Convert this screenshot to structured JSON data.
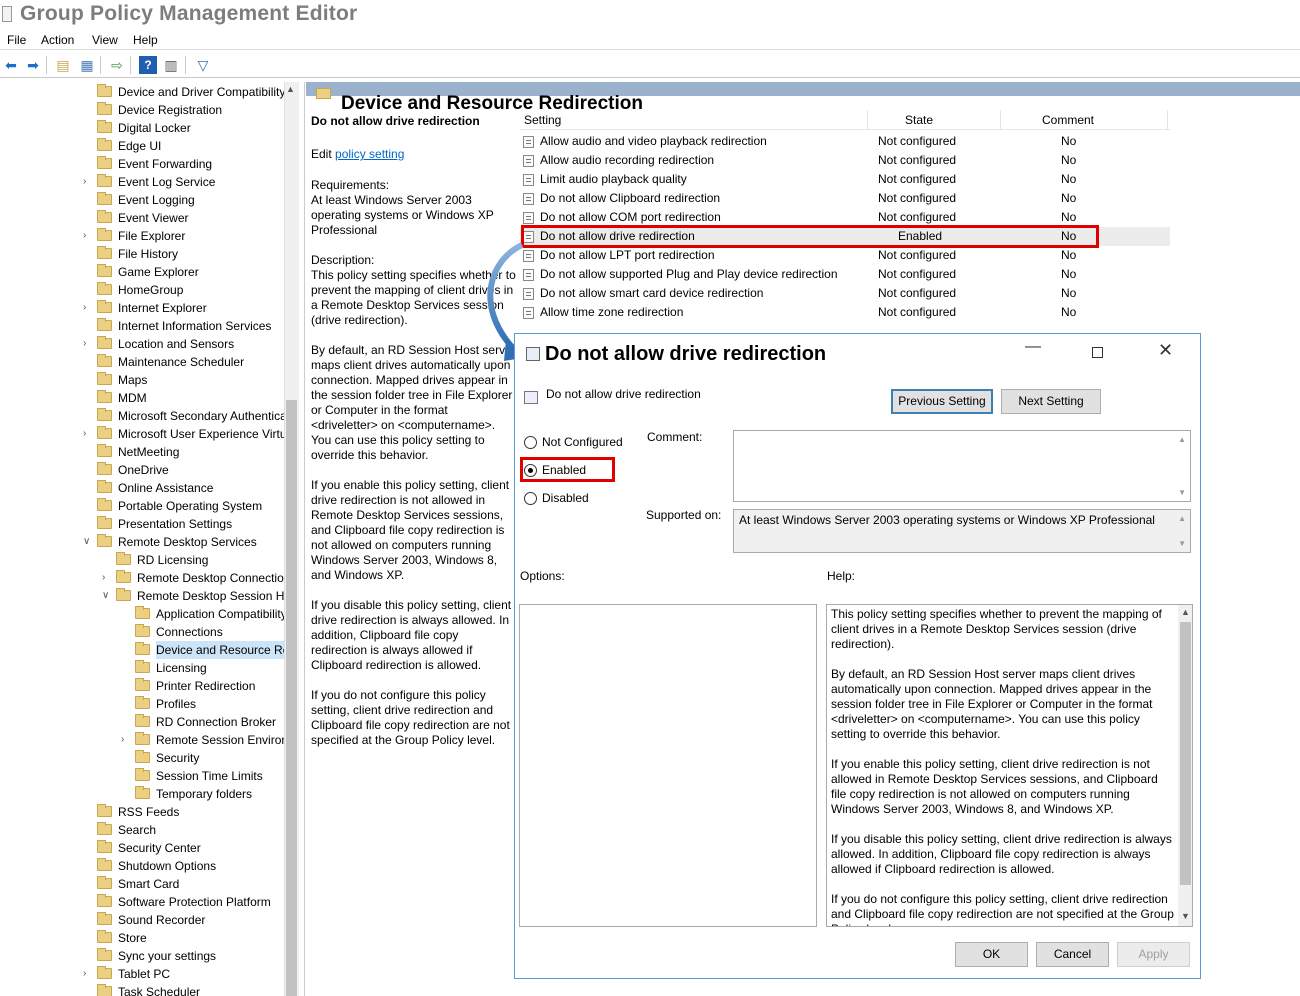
{
  "app": {
    "title": "Group Policy Management Editor"
  },
  "menu": [
    "File",
    "Action",
    "View",
    "Help"
  ],
  "icons": {
    "back": "back-arrow-icon",
    "forward": "forward-arrow-icon",
    "folder": "folder-icon",
    "filter": "filter-icon",
    "help": "help-icon"
  },
  "colors": {
    "highlight": "#e00000",
    "header_bar": "#9bb2ce",
    "accent": "#3c7fb1",
    "link": "#0066cc"
  },
  "tree": [
    "Device and Driver Compatibility",
    "Device Registration",
    "Digital Locker",
    "Edge UI",
    "Event Forwarding",
    "Event Log Service",
    "Event Logging",
    "Event Viewer",
    "File Explorer",
    "File History",
    "Game Explorer",
    "HomeGroup",
    "Internet Explorer",
    "Internet Information Services",
    "Location and Sensors",
    "Maintenance Scheduler",
    "Maps",
    "MDM",
    "Microsoft Secondary Authentication",
    "Microsoft User Experience Virtualization",
    "NetMeeting",
    "OneDrive",
    "Online Assistance",
    "Portable Operating System",
    "Presentation Settings",
    "Remote Desktop Services",
    "RD Licensing",
    "Remote Desktop Connection Client",
    "Remote Desktop Session Host",
    "Application Compatibility",
    "Connections",
    "Device and Resource Redirection",
    "Licensing",
    "Printer Redirection",
    "Profiles",
    "RD Connection Broker",
    "Remote Session Environment",
    "Security",
    "Session Time Limits",
    "Temporary folders",
    "RSS Feeds",
    "Search",
    "Security Center",
    "Shutdown Options",
    "Smart Card",
    "Software Protection Platform",
    "Sound Recorder",
    "Store",
    "Sync your settings",
    "Tablet PC",
    "Task Scheduler"
  ],
  "section": {
    "title": "Device and Resource Redirection"
  },
  "description": {
    "heading": "Do not allow drive redirection",
    "edit_prefix": "Edit",
    "edit_link": "policy setting",
    "requirements_label": "Requirements:",
    "requirements": "At least Windows Server 2003 operating systems or Windows XP Professional",
    "description_label": "Description:",
    "p1": "This policy setting specifies whether to prevent the mapping of client drives in a Remote Desktop Services session (drive redirection).",
    "p2": "By default, an RD Session Host server maps client drives automatically upon connection. Mapped drives appear in the session folder tree in File Explorer or Computer in the format <driveletter> on <computername>. You can use this policy setting to override this behavior.",
    "p3": "If you enable this policy setting, client drive redirection is not allowed in Remote Desktop Services sessions, and Clipboard file copy redirection is not allowed on computers running Windows Server 2003, Windows 8, and Windows XP.",
    "p4": "If you disable this policy setting, client drive redirection is always allowed. In addition, Clipboard file copy redirection is always allowed if Clipboard redirection is allowed.",
    "p5": "If you do not configure this policy setting, client drive redirection and Clipboard file copy redirection are not specified at the Group Policy level."
  },
  "settings": {
    "columns": {
      "setting": "Setting",
      "state": "State",
      "comment": "Comment"
    },
    "rows": [
      {
        "name": "Allow audio and video playback redirection",
        "state": "Not configured",
        "comment": "No"
      },
      {
        "name": "Allow audio recording redirection",
        "state": "Not configured",
        "comment": "No"
      },
      {
        "name": "Limit audio playback quality",
        "state": "Not configured",
        "comment": "No"
      },
      {
        "name": "Do not allow Clipboard redirection",
        "state": "Not configured",
        "comment": "No"
      },
      {
        "name": "Do not allow COM port redirection",
        "state": "Not configured",
        "comment": "No"
      },
      {
        "name": "Do not allow drive redirection",
        "state": "Enabled",
        "comment": "No"
      },
      {
        "name": "Do not allow LPT port redirection",
        "state": "Not configured",
        "comment": "No"
      },
      {
        "name": "Do not allow supported Plug and Play device redirection",
        "state": "Not configured",
        "comment": "No"
      },
      {
        "name": "Do not allow smart card device redirection",
        "state": "Not configured",
        "comment": "No"
      },
      {
        "name": "Allow time zone redirection",
        "state": "Not configured",
        "comment": "No"
      }
    ]
  },
  "dialog": {
    "title": "Do not allow drive redirection",
    "policy_name": "Do not allow drive redirection",
    "prev_button": "Previous Setting",
    "next_button": "Next Setting",
    "radio_not_configured": "Not Configured",
    "radio_enabled": "Enabled",
    "radio_disabled": "Disabled",
    "selected": "Enabled",
    "comment_label": "Comment:",
    "supported_label": "Supported on:",
    "supported_value": "At least Windows Server 2003 operating systems or Windows XP Professional",
    "options_label": "Options:",
    "help_label": "Help:",
    "help_p1": "This policy setting specifies whether to prevent the mapping of client drives in a Remote Desktop Services session (drive redirection).",
    "help_p2": "By default, an RD Session Host server maps client drives automatically upon connection. Mapped drives appear in the session folder tree in File Explorer or Computer in the format <driveletter> on <computername>. You can use this policy setting to override this behavior.",
    "help_p3": "If you enable this policy setting, client drive redirection is not allowed in Remote Desktop Services sessions, and Clipboard file copy redirection is not allowed on computers running Windows Server 2003, Windows 8, and Windows XP.",
    "help_p4": "If you disable this policy setting, client drive redirection is always allowed. In addition, Clipboard file copy redirection is always allowed if Clipboard redirection is allowed.",
    "help_p5": "If you do not configure this policy setting, client drive redirection and Clipboard file copy redirection are not specified at the Group Policy level.",
    "ok": "OK",
    "cancel": "Cancel",
    "apply": "Apply"
  }
}
